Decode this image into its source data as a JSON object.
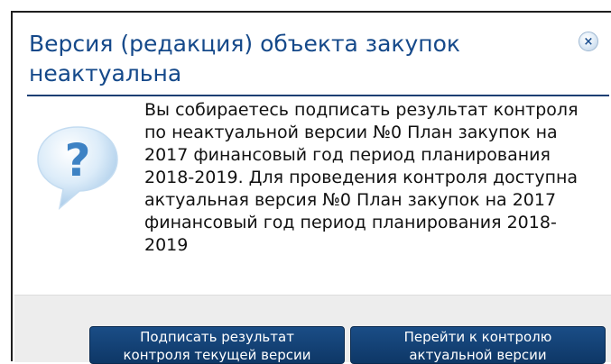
{
  "dialog": {
    "title": "Версия (редакция) объекта закупок неактуальна",
    "close_icon": "close-icon",
    "question_icon": "question-icon",
    "message": "Вы собираетесь подписать результат контроля по неактуальной версии №0 План закупок на 2017 финансовый год период планирования 2018-2019. Для проведения контроля доступна актуальная версия №0 План закупок на 2017 финансовый год период планирования 2018-2019",
    "buttons": {
      "sign": {
        "line1": "Подписать результат",
        "line2": "контроля текущей версии"
      },
      "goto": {
        "line1": "Перейти к контролю",
        "line2": "актуальной версии"
      }
    }
  },
  "colors": {
    "title": "#15498a",
    "button": "#1a4d86",
    "footer": "#ededed",
    "icon": "#3d82c4"
  }
}
